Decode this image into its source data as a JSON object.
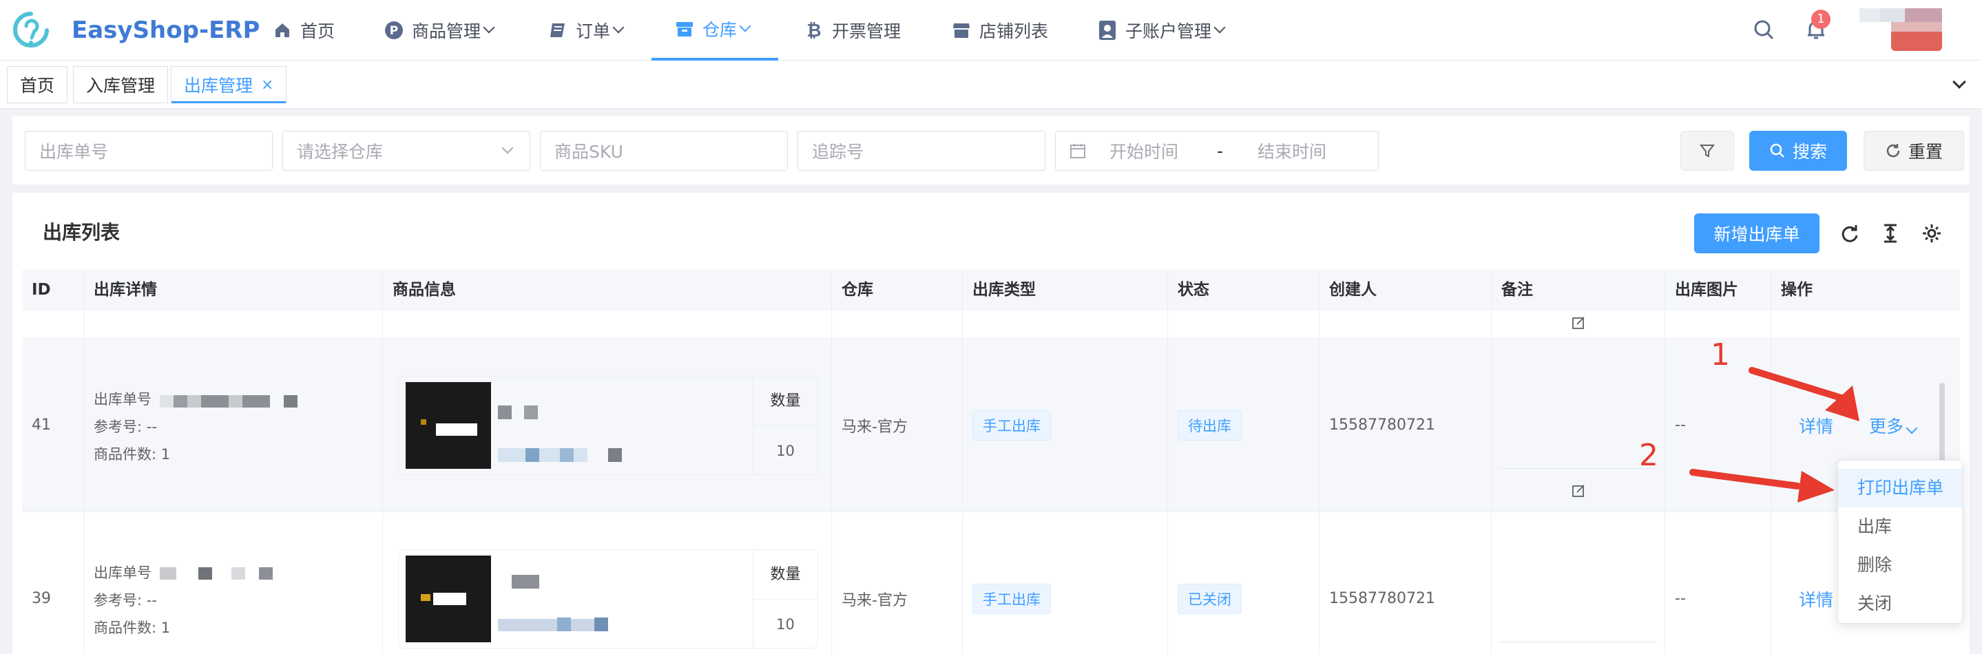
{
  "header": {
    "brand": "EasyShop-ERP",
    "nav": [
      {
        "label": "首页",
        "icon": "home-icon",
        "dropdown": false
      },
      {
        "label": "商品管理",
        "icon": "product-p-icon",
        "dropdown": true
      },
      {
        "label": "订单",
        "icon": "book-icon",
        "dropdown": true
      },
      {
        "label": "仓库",
        "icon": "warehouse-box-icon",
        "dropdown": true,
        "active": true
      },
      {
        "label": "开票管理",
        "icon": "bitcoin-icon",
        "dropdown": false
      },
      {
        "label": "店铺列表",
        "icon": "store-icon",
        "dropdown": false
      },
      {
        "label": "子账户管理",
        "icon": "user-badge-icon",
        "dropdown": true
      }
    ],
    "notification_count": "1"
  },
  "tags": [
    {
      "label": "首页"
    },
    {
      "label": "入库管理"
    },
    {
      "label": "出库管理",
      "active": true,
      "close": "×"
    }
  ],
  "filter": {
    "outbound_no_placeholder": "出库单号",
    "warehouse_placeholder": "请选择仓库",
    "sku_placeholder": "商品SKU",
    "tracking_placeholder": "追踪号",
    "start_placeholder": "开始时间",
    "range_sep": "-",
    "end_placeholder": "结束时间",
    "search_label": "搜索",
    "reset_label": "重置"
  },
  "list": {
    "title": "出库列表",
    "add_label": "新增出库单",
    "columns": [
      "ID",
      "出库详情",
      "商品信息",
      "仓库",
      "出库类型",
      "状态",
      "创建人",
      "备注",
      "出库图片",
      "操作"
    ],
    "rows": [
      {
        "id": "41",
        "outbound_no_label": "出库单号",
        "ref_label": "参考号: --",
        "item_count_label": "商品件数: 1",
        "qty_header": "数量",
        "qty": "10",
        "warehouse": "马来-官方",
        "type": "手工出库",
        "status": "待出库",
        "creator": "15587780721",
        "image": "--",
        "detail_label": "详情",
        "more_label": "更多"
      },
      {
        "id": "39",
        "outbound_no_label": "出库单号",
        "ref_label": "参考号: --",
        "item_count_label": "商品件数: 1",
        "qty_header": "数量",
        "qty": "10",
        "warehouse": "马来-官方",
        "type": "手工出库",
        "status": "已关闭",
        "creator": "15587780721",
        "image": "--",
        "detail_label": "详情"
      }
    ]
  },
  "more_menu": [
    "打印出库单",
    "出库",
    "删除",
    "关闭"
  ],
  "annotations": {
    "one": "1",
    "two": "2",
    "color": "#e63b2e"
  },
  "colors": {
    "primary": "#409eff",
    "brand": "#3f7ad6",
    "badge": "#f56c6c"
  }
}
